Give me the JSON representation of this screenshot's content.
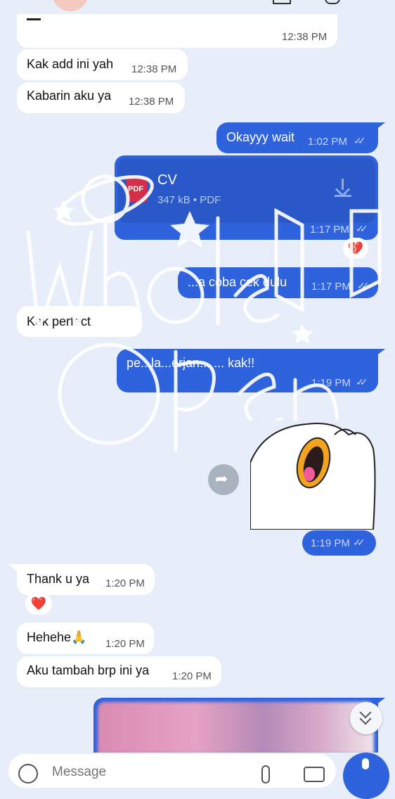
{
  "messages": {
    "m0_time": "12:38 PM",
    "m1_text": "Kak add ini yah",
    "m1_time": "12:38 PM",
    "m2_text": "Kabarin aku ya",
    "m2_time": "12:38 PM",
    "m3_text": "Okayyy wait",
    "m3_time": "1:02 PM",
    "file_name": "CV",
    "file_meta": "347 kB • PDF",
    "file_badge": "PDF",
    "file_time": "1:17 PM",
    "m5_text": "...a coba cek dulu",
    "m5_time": "1:17 PM",
    "m6_text": "Kak perfect",
    "m7_text": "pe...la...erjan... ... kak!!",
    "m7_time": "1:19 PM",
    "sticker_time": "1:19 PM",
    "m8_text": "Thank u ya",
    "m8_time": "1:20 PM",
    "m9_text": "Hehehe🙏",
    "m9_time": "1:20 PM",
    "m10_text": "Aku tambah brp ini ya",
    "m10_time": "1:20 PM"
  },
  "reactions": {
    "broken_heart": "💔",
    "heart": "❤️"
  },
  "input": {
    "placeholder": "Message"
  },
  "icons": {
    "forward": "share-forward-icon",
    "scroll_down": "chevron-double-down-icon",
    "attach": "paperclip-icon",
    "camera": "camera-icon",
    "mic": "microphone-icon",
    "emoji": "emoji-icon"
  },
  "colors": {
    "background": "#e7eef9",
    "outgoing": "#2f62dd",
    "incoming": "#ffffff",
    "mic_button": "#2f62dd"
  }
}
